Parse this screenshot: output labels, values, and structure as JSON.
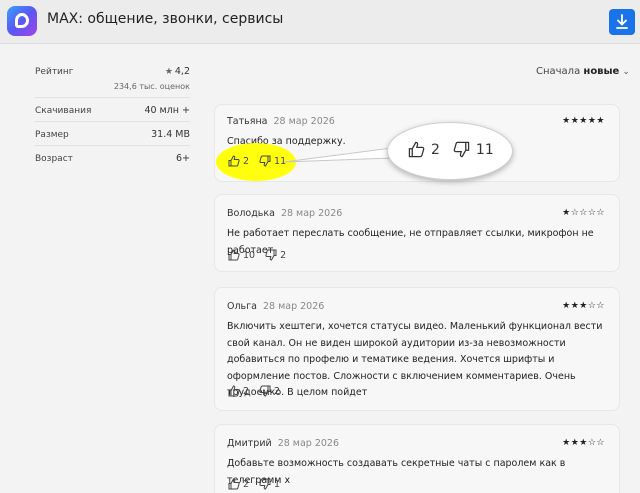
{
  "header": {
    "app_title": "MAX: общение, звонки, сервисы",
    "app_icon": "max-app-icon",
    "download_icon": "download-icon",
    "accent_color": "#1a73e8"
  },
  "sidebar": {
    "rating_label": "Рейтинг",
    "rating_value": "4,2",
    "rating_count": "234,6 тыс. оценок",
    "downloads_label": "Скачивания",
    "downloads_value": "40 млн +",
    "size_label": "Размер",
    "size_value": "31.4 MB",
    "age_label": "Возраст",
    "age_value": "6+"
  },
  "sort": {
    "label": "Сначала",
    "value": "новые"
  },
  "magnifier": {
    "likes": "2",
    "dislikes": "11"
  },
  "reviews": [
    {
      "author": "Татьяна",
      "date": "28 мар 2026",
      "stars": 5,
      "text": "Спасибо за поддержку.",
      "likes": "2",
      "dislikes": "11"
    },
    {
      "author": "Володька",
      "date": "28 мар 2026",
      "stars": 1,
      "text": "Не работает переслать сообщение, не отправляет ссылки, микрофон не работает",
      "likes": "10",
      "dislikes": "2"
    },
    {
      "author": "Ольга",
      "date": "28 мар 2026",
      "stars": 3,
      "text": "Включить хештеги, хочется статусы видео. Маленький функционал вести свой канал. Он не виден широкой аудитории из-за невозможности добавиться по профелю и тематике ведения. Хочется шрифты и оформление постов. Сложности с включением комментариев. Очень трудоемко. В целом пойдет",
      "likes": "2",
      "dislikes": "2"
    },
    {
      "author": "Дмитрий",
      "date": "28 мар 2026",
      "stars": 3,
      "text": "Добавьте возможность создавать секретные чаты с паролем как в телеграмм х",
      "likes": "2",
      "dislikes": "1"
    }
  ]
}
